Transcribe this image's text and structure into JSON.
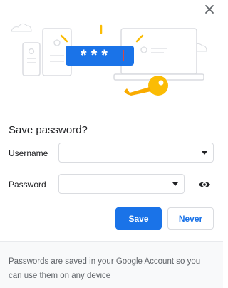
{
  "dialog": {
    "title": "Save password?",
    "close_icon": "close-icon"
  },
  "illustration": {
    "masked_text": "* * *"
  },
  "form": {
    "username_label": "Username",
    "username_value": "",
    "password_label": "Password",
    "password_value": ""
  },
  "actions": {
    "save_label": "Save",
    "never_label": "Never"
  },
  "footer": {
    "text": "Passwords are saved in your Google Account so you can use them on any device"
  },
  "colors": {
    "accent": "#1a73e8",
    "key": "#fbbc04"
  }
}
